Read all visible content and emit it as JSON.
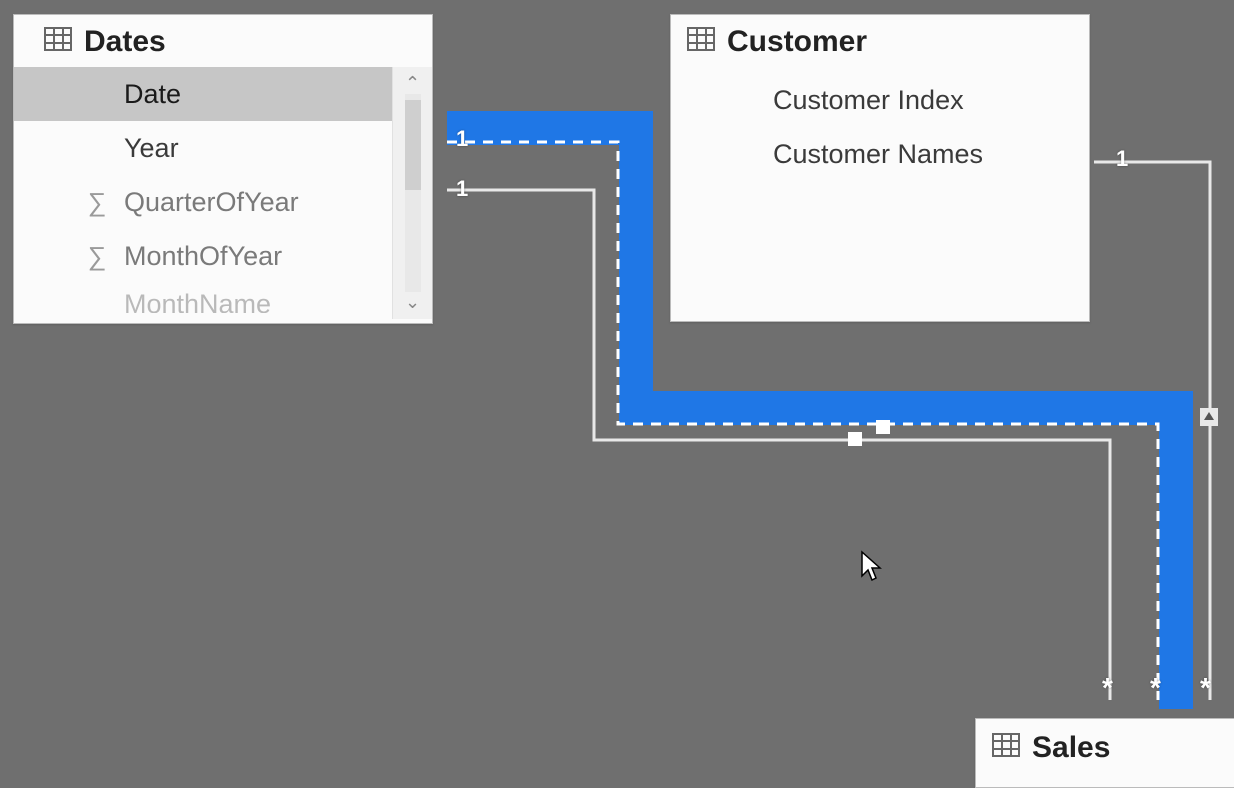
{
  "tables": {
    "dates": {
      "title": "Dates",
      "fields": [
        {
          "label": "Date",
          "selected": true,
          "measure": false
        },
        {
          "label": "Year",
          "selected": false,
          "measure": false
        },
        {
          "label": "QuarterOfYear",
          "selected": false,
          "measure": true
        },
        {
          "label": "MonthOfYear",
          "selected": false,
          "measure": true
        },
        {
          "label": "MonthName",
          "selected": false,
          "measure": false,
          "partial": true
        }
      ]
    },
    "customer": {
      "title": "Customer",
      "fields": [
        {
          "label": "Customer Index"
        },
        {
          "label": "Customer Names"
        }
      ]
    },
    "sales": {
      "title": "Sales"
    }
  },
  "relationships": {
    "dates_to_unknown_inactive": {
      "from_card": "1",
      "to_card": "*",
      "active": false
    },
    "dates_to_sales_active": {
      "from_card": "1",
      "to_card": "*",
      "active": true
    },
    "customer_to_sales": {
      "from_card": "1",
      "to_card": "*",
      "active": true
    }
  },
  "colors": {
    "selected_relationship": "#1f77e6",
    "canvas_bg": "#6f6f6f"
  }
}
